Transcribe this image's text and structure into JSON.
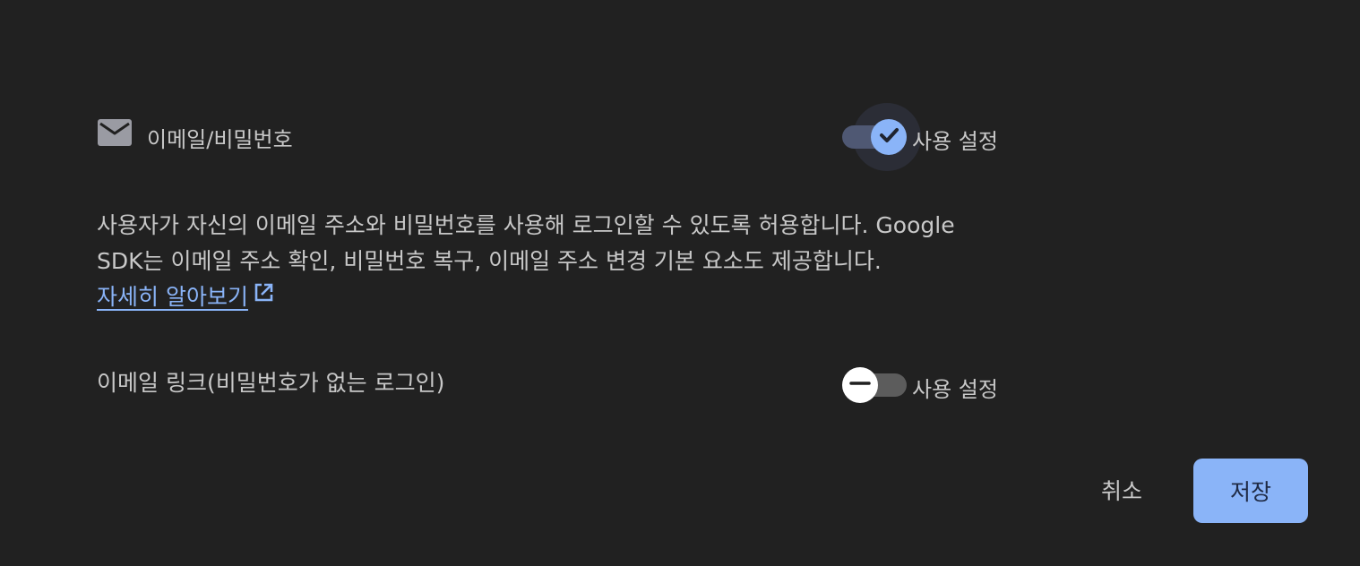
{
  "provider": {
    "icon": "mail-icon",
    "name": "이메일/비밀번호",
    "toggle_label": "사용 설정",
    "enabled": true
  },
  "description": {
    "line1": "사용자가 자신의 이메일 주소와 비밀번호를 사용해 로그인할 수 있도록 허용합니다. Google",
    "line2": "SDK는 이메일 주소 확인, 비밀번호 복구, 이메일 주소 변경 기본 요소도 제공합니다.",
    "link_label": "자세히 알아보기",
    "link_icon": "open-in-new-icon"
  },
  "email_link": {
    "label": "이메일 링크(비밀번호가 없는 로그인)",
    "toggle_label": "사용 설정",
    "enabled": false
  },
  "actions": {
    "cancel_label": "취소",
    "save_label": "저장"
  },
  "colors": {
    "background": "#212121",
    "accent": "#8ab4f8",
    "text": "#c8c8c8"
  }
}
